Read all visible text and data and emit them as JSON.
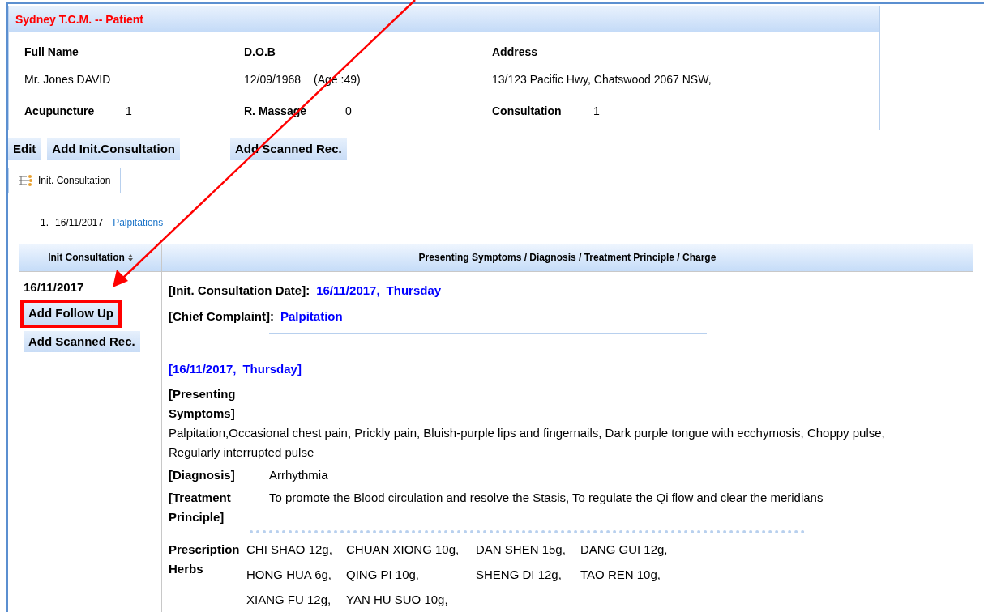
{
  "panel": {
    "title": "Sydney T.C.M. -- Patient",
    "fields": [
      {
        "label": "Full Name",
        "value": "Mr. Jones DAVID"
      },
      {
        "label": "D.O.B",
        "value": "12/09/1968",
        "extra": "(Age :49)"
      },
      {
        "label": "Address",
        "value": "13/123 Pacific Hwy, Chatswood 2067 NSW,"
      }
    ],
    "counts": [
      {
        "label": "Acupuncture",
        "value": "1"
      },
      {
        "label": "R. Massage",
        "value": "0"
      },
      {
        "label": "Consultation",
        "value": "1"
      }
    ]
  },
  "actions": [
    "Edit",
    "Add Init.Consultation",
    "Add Scanned Rec."
  ],
  "tabs": [
    {
      "label": "Init. Consultation",
      "selected": true
    }
  ],
  "consult_list": [
    {
      "number": "1.",
      "date": "16/11/2017",
      "link": "Palpitations"
    }
  ],
  "table": {
    "columns": [
      {
        "label": "Init Consultation",
        "sortable": true
      },
      {
        "label": "Presenting Symptoms /  Diagnosis /  Treatment Principle /  Charge",
        "sortable": false
      }
    ],
    "row": {
      "date": "16/11/2017",
      "buttons": [
        {
          "label": "Add Follow Up",
          "highlighted": true
        },
        {
          "label": "Add Scanned Rec.",
          "highlighted": false
        }
      ],
      "init_date_label": "[Init. Consultation Date]:",
      "init_date": "16/11/2017,",
      "init_day": "Thursday",
      "complaint_label": "[Chief Complaint]:",
      "complaint": "Palpitation",
      "visit_date": "[16/11/2017,",
      "visit_day": "Thursday]",
      "sections": [
        {
          "kind": "block",
          "label": "[Presenting Symptoms]",
          "text": "Palpitation,Occasional chest pain, Prickly pain, Bluish-purple lips and fingernails, Dark purple tongue with ecchymosis, Choppy pulse, Regularly interrupted pulse"
        },
        {
          "kind": "inline",
          "label": "[Diagnosis]",
          "text": "Arrhythmia"
        },
        {
          "kind": "inline",
          "label": "[Treatment Principle]",
          "text": "To promote the Blood circulation and resolve the Stasis, To regulate the Qi flow and clear the meridians"
        }
      ],
      "herbs_label": "Prescription Herbs",
      "herbs": [
        "CHI SHAO 12g,",
        "CHUAN XIONG 10g,",
        "DAN SHEN 15g,",
        "DANG GUI 12g,",
        "HONG HUA 6g,",
        "QING PI 10g,",
        "SHENG DI 12g,",
        "TAO REN 10g,",
        "XIANG FU 12g,",
        "YAN HU SUO 10g,"
      ]
    }
  }
}
